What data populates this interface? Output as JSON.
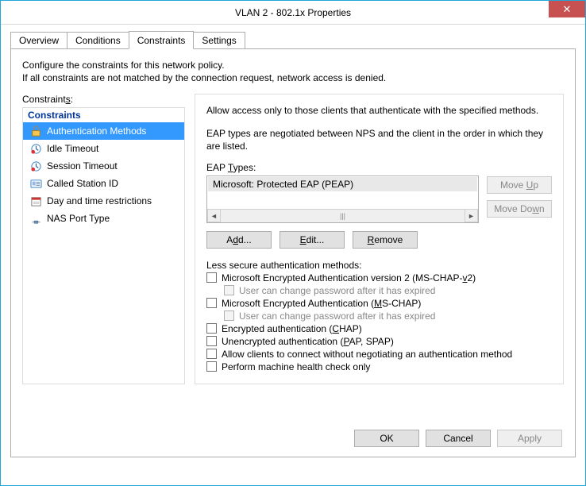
{
  "window": {
    "title": "VLAN 2 - 802.1x Properties"
  },
  "tabs": [
    {
      "label": "Overview"
    },
    {
      "label": "Conditions"
    },
    {
      "label": "Constraints",
      "active": true
    },
    {
      "label": "Settings"
    }
  ],
  "description_line1": "Configure the constraints for this network policy.",
  "description_line2": "If all constraints are not matched by the connection request, network access is denied.",
  "constraints_label_pre": "Constraint",
  "constraints_label_u": "s",
  "constraints_label_post": ":",
  "group_title": "Constraints",
  "nav": [
    {
      "label": "Authentication Methods",
      "icon": "lock-icon",
      "sel": true
    },
    {
      "label": "Idle Timeout",
      "icon": "idle-icon"
    },
    {
      "label": "Session Timeout",
      "icon": "session-icon"
    },
    {
      "label": "Called Station ID",
      "icon": "id-icon"
    },
    {
      "label": "Day and time restrictions",
      "icon": "calendar-icon"
    },
    {
      "label": "NAS Port Type",
      "icon": "port-icon"
    }
  ],
  "right": {
    "heading": "Allow access only to those clients that authenticate with the specified methods.",
    "eap_desc": "EAP types are negotiated between NPS and the client in the order in which they are listed.",
    "eap_label_pre": "EAP ",
    "eap_label_u": "T",
    "eap_label_post": "ypes:",
    "eap_list": [
      "Microsoft: Protected EAP (PEAP)"
    ],
    "move_up_pre": "Move ",
    "move_up_u": "U",
    "move_up_post": "p",
    "move_down_pre": "Move Do",
    "move_down_u": "w",
    "move_down_post": "n",
    "add_u": "d",
    "add_pre": "A",
    "add_post": "d...",
    "edit_u": "E",
    "edit_post": "dit...",
    "remove_u": "R",
    "remove_post": "emove",
    "less_label": "Less secure authentication methods:",
    "checks": [
      {
        "pre": "Microsoft Encrypted Authentication version 2 (MS-CHAP-",
        "u": "v",
        "post": "2)"
      },
      {
        "sub": true,
        "text": "User can change password after it has expired"
      },
      {
        "pre": "Microsoft Encrypted Authentication (",
        "u": "M",
        "post": "S-CHAP)"
      },
      {
        "sub": true,
        "text": "User can change password after it has expired"
      },
      {
        "pre": "Encrypted authentication (",
        "u": "C",
        "post": "HAP)"
      },
      {
        "pre": "Unencrypted authentication (",
        "u": "P",
        "post": "AP, SPAP)"
      },
      {
        "text": "Allow clients to connect without negotiating an authentication method"
      },
      {
        "text": "Perform machine health check only"
      }
    ]
  },
  "dlg": {
    "ok": "OK",
    "cancel": "Cancel",
    "apply": "Apply"
  }
}
